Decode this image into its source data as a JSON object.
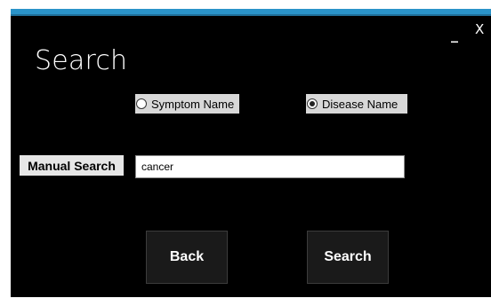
{
  "window": {
    "title": "Search",
    "minimize_label": "_",
    "close_label": "X"
  },
  "search_type": {
    "options": [
      {
        "label": "Symptom Name",
        "checked": false
      },
      {
        "label": "Disease Name",
        "checked": true
      }
    ]
  },
  "manual_search": {
    "label": "Manual Search",
    "value": "cancer"
  },
  "buttons": {
    "back": "Back",
    "search": "Search"
  },
  "colors": {
    "background": "#000000",
    "accent_bar": "#2a93c9",
    "button_bg": "#1a1a1a"
  }
}
